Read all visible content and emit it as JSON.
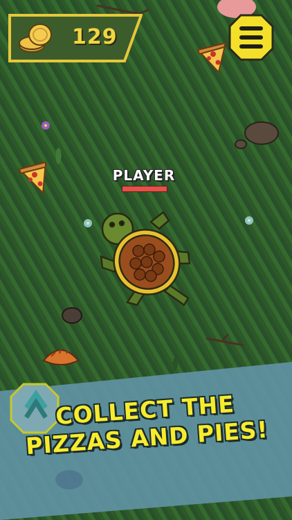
{
  "hud": {
    "coins": "129",
    "coin_icon": "coin-stack-icon",
    "menu_icon": "hamburger-menu-icon"
  },
  "player": {
    "name": "PLAYER",
    "health_fraction": 1.0
  },
  "caption": {
    "line1": "COLLECT THE",
    "line2": "PIZZAS AND PIES!"
  },
  "colors": {
    "accent_yellow": "#f6ec2e",
    "coin_text": "#f2d640",
    "health": "#e0524a",
    "banner": "#5f93a3"
  }
}
